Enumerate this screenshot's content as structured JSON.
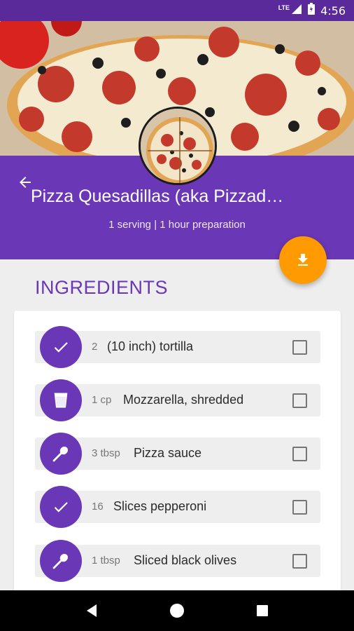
{
  "status_bar": {
    "network": "LTE",
    "time": "4:56"
  },
  "recipe": {
    "title": "Pizza Quesadillas (aka Pizzad…",
    "subtitle": "1 serving | 1 hour preparation"
  },
  "section": {
    "title": "INGREDIENTS"
  },
  "ingredients": [
    {
      "icon": "check-icon",
      "qty": "2",
      "name": "(10 inch) tortilla",
      "checked": false
    },
    {
      "icon": "cup-icon",
      "qty": "1 cp",
      "name": "Mozzarella, shredded",
      "checked": false
    },
    {
      "icon": "spoon-icon",
      "qty": "3 tbsp",
      "name": "Pizza sauce",
      "checked": false
    },
    {
      "icon": "check-icon",
      "qty": "16",
      "name": "Slices pepperoni",
      "checked": false
    },
    {
      "icon": "spoon-icon",
      "qty": "1 tbsp",
      "name": "Sliced black olives",
      "checked": false
    }
  ],
  "colors": {
    "primary": "#6a37b6",
    "status": "#5b2a9a",
    "accent": "#ff9a00"
  }
}
